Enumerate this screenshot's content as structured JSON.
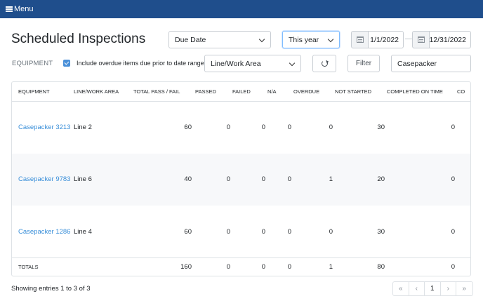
{
  "header": {
    "menu_label": "Menu"
  },
  "page": {
    "title": "Scheduled Inspections"
  },
  "filters": {
    "date_field_select": "Due Date",
    "period_select": "This year",
    "start_date": "1/1/2022",
    "date_separator": "—",
    "end_date": "12/31/2022",
    "equipment_label": "EQUIPMENT",
    "include_overdue_label": "Include overdue items due prior to date range",
    "include_overdue_checked": true,
    "line_select": "Line/Work Area",
    "filter_button": "Filter",
    "search_value": "Casepacker"
  },
  "table": {
    "headers": [
      "EQUIPMENT",
      "LINE/WORK AREA",
      "TOTAL PASS / FAIL",
      "PASSED",
      "FAILED",
      "N/A",
      "OVERDUE",
      "NOT STARTED",
      "COMPLETED ON TIME",
      "CO"
    ],
    "rows": [
      {
        "equipment": "Casepacker 3213",
        "line": "Line 2",
        "total": "60",
        "passed": "0",
        "failed": "0",
        "na": "0",
        "overdue": "0",
        "not_started": "30",
        "completed_on_time": "0"
      },
      {
        "equipment": "Casepacker 9783",
        "line": "Line 6",
        "total": "40",
        "passed": "0",
        "failed": "0",
        "na": "0",
        "overdue": "1",
        "not_started": "20",
        "completed_on_time": "0"
      },
      {
        "equipment": "Casepacker 1286",
        "line": "Line 4",
        "total": "60",
        "passed": "0",
        "failed": "0",
        "na": "0",
        "overdue": "0",
        "not_started": "30",
        "completed_on_time": "0"
      }
    ],
    "totals": {
      "label": "TOTALS",
      "total": "160",
      "passed": "0",
      "failed": "0",
      "na": "0",
      "overdue": "1",
      "not_started": "80",
      "completed_on_time": "0"
    }
  },
  "footer": {
    "showing": "Showing entries 1 to 3 of 3",
    "pager": {
      "first": "«",
      "prev": "‹",
      "page": "1",
      "next": "›",
      "last": "»"
    }
  },
  "colors": {
    "topbar": "#1f4e8c",
    "link": "#3a8fd9",
    "checkbox": "#4a90d9"
  }
}
